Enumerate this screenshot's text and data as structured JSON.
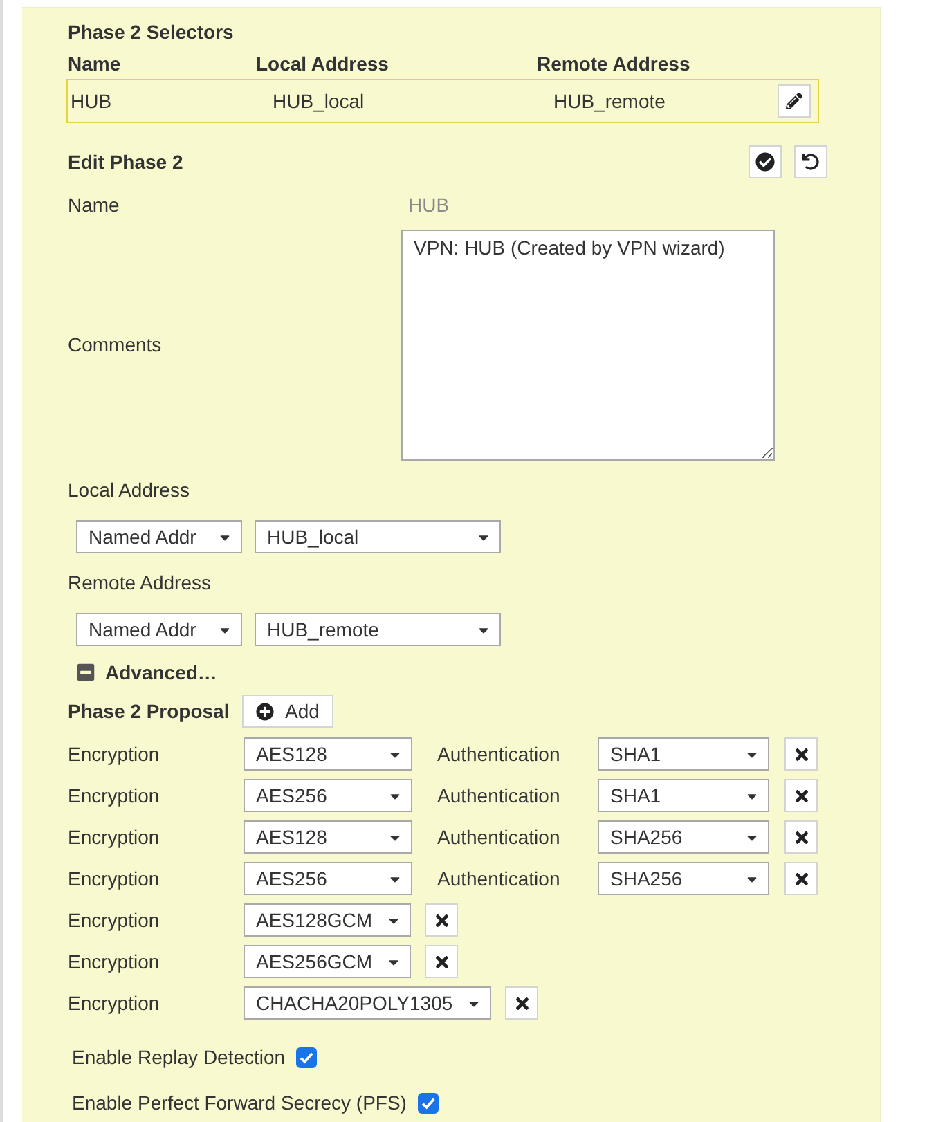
{
  "selectors": {
    "title": "Phase 2 Selectors",
    "columns": [
      "Name",
      "Local Address",
      "Remote Address"
    ],
    "rows": [
      {
        "cells": [
          "HUB",
          "HUB_local",
          "HUB_remote"
        ],
        "selected": true
      }
    ]
  },
  "edit_phase2": {
    "title": "Edit Phase 2",
    "name": {
      "label": "Name",
      "value": "HUB"
    },
    "comments": {
      "label": "Comments",
      "value": "VPN: HUB (Created by VPN wizard)"
    },
    "local_address": {
      "label": "Local Address",
      "type": "Named Addr",
      "value": "HUB_local"
    },
    "remote_address": {
      "label": "Remote Address",
      "type": "Named Addr",
      "value": "HUB_remote"
    }
  },
  "advanced": {
    "label": "Advanced…",
    "expanded": true
  },
  "proposal": {
    "label": "Phase 2 Proposal",
    "add_button": "Add",
    "rows": [
      {
        "kind": "with_auth",
        "encryption_label": "Encryption",
        "encryption": "AES128",
        "authentication_label": "Authentication",
        "authentication": "SHA1"
      },
      {
        "kind": "with_auth",
        "encryption_label": "Encryption",
        "encryption": "AES256",
        "authentication_label": "Authentication",
        "authentication": "SHA1"
      },
      {
        "kind": "with_auth",
        "encryption_label": "Encryption",
        "encryption": "AES128",
        "authentication_label": "Authentication",
        "authentication": "SHA256"
      },
      {
        "kind": "with_auth",
        "encryption_label": "Encryption",
        "encryption": "AES256",
        "authentication_label": "Authentication",
        "authentication": "SHA256"
      },
      {
        "kind": "encryption_only",
        "encryption_label": "Encryption",
        "encryption": "AES128GCM"
      },
      {
        "kind": "encryption_only",
        "encryption_label": "Encryption",
        "encryption": "AES256GCM"
      },
      {
        "kind": "encryption_only",
        "encryption_label": "Encryption",
        "encryption": "CHACHA20POLY1305"
      }
    ]
  },
  "options": [
    {
      "label": "Enable Replay Detection",
      "checked": true
    },
    {
      "label": "Enable Perfect Forward Secrecy (PFS)",
      "checked": true
    }
  ]
}
